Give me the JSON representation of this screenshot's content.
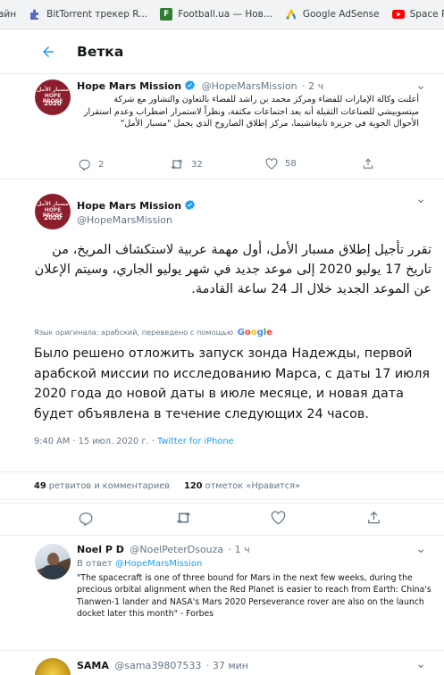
{
  "bookmarks": [
    {
      "label": "айн",
      "icon": "",
      "icon_color": "#ffffff"
    },
    {
      "label": "BitTorrent трекер R...",
      "icon": "puzzle-icon",
      "icon_color": "#3f51b5"
    },
    {
      "label": "Football.ua — Нов...",
      "icon": "F",
      "icon_color": "#2e7d32"
    },
    {
      "label": "Google AdSense",
      "icon": "adsense-icon",
      "icon_color": "#fbbc04"
    },
    {
      "label": "Space Room - YouT...",
      "icon": "youtube-icon",
      "icon_color": "#ff0000"
    }
  ],
  "header": {
    "title": "Ветка"
  },
  "avatar": {
    "text_line1": "مسبار الأمل",
    "text_line2": "HOPE PROBE",
    "year": "2020"
  },
  "tweet1": {
    "name": "Hope Mars Mission",
    "handle": "@HopeMarsMission",
    "time": "· 2 ч",
    "text": "أعلنت وكالة الإمارات للفضاء ومركز محمد بن راشد للفضاء بالتعاون والتشاور مع شركة ميتسوبيشي للصناعات الثقيلة أنه بعد اجتماعات مكثفة، ونظراً لاستمرار اضطراب وعدم استقرار الأحوال الجوية في جزيرة تانيغاشيما، مركز إطلاق الصاروخ الذي يحمل \"مسبار الأمل\"",
    "replies": "2",
    "retweets": "32",
    "likes": "58"
  },
  "main": {
    "name": "Hope Mars Mission",
    "handle": "@HopeMarsMission",
    "text_ar": "تقرر تأجيل إطلاق مسبار الأمل، أول مهمة عربية لاستكشاف المريخ، من تاريخ 17 يوليو 2020 إلى موعد جديد في شهر يوليو الجاري، وسيتم الإعلان عن الموعد الجديد خلال الـ 24 ساعة القادمة.",
    "translation_note": "Язык оригинала: арабский, переведено с помощью",
    "translation_brand": "Google",
    "text_ru": "Было решено отложить запуск зонда Надежды, первой арабской миссии по исследованию Марса, с даты 17 июля 2020 года до новой даты в июле месяце, и новая дата будет объявлена в течение следующих 24 часов.",
    "meta_time": "9:40 AM · 15 июл. 2020 г. · ",
    "meta_source": "Twitter for iPhone",
    "retweets_count": "49",
    "retweets_label": "ретвитов и комментариев",
    "likes_count": "120",
    "likes_label": "отметок «Нравится»"
  },
  "reply1": {
    "name": "Noel P D",
    "handle": "@NoelPeterDsouza",
    "time": "· 1 ч",
    "in_reply_label": "В ответ",
    "in_reply_handle": "@HopeMarsMission",
    "text": "\"The spacecraft is one of three bound for Mars in the next few weeks, during the precious orbital alignment when the Red Planet is easier to reach from Earth: China's Tianwen-1 lander and NASA's Mars 2020 Perseverance rover are also on the launch docket later this month\" - Forbes"
  },
  "reply2": {
    "name": "SAMA",
    "handle": "@sama39807533",
    "time": "· 37 мин"
  },
  "colors": {
    "accent": "#1da1f2",
    "muted": "#657786",
    "brand_red": "#8b1e2c"
  }
}
